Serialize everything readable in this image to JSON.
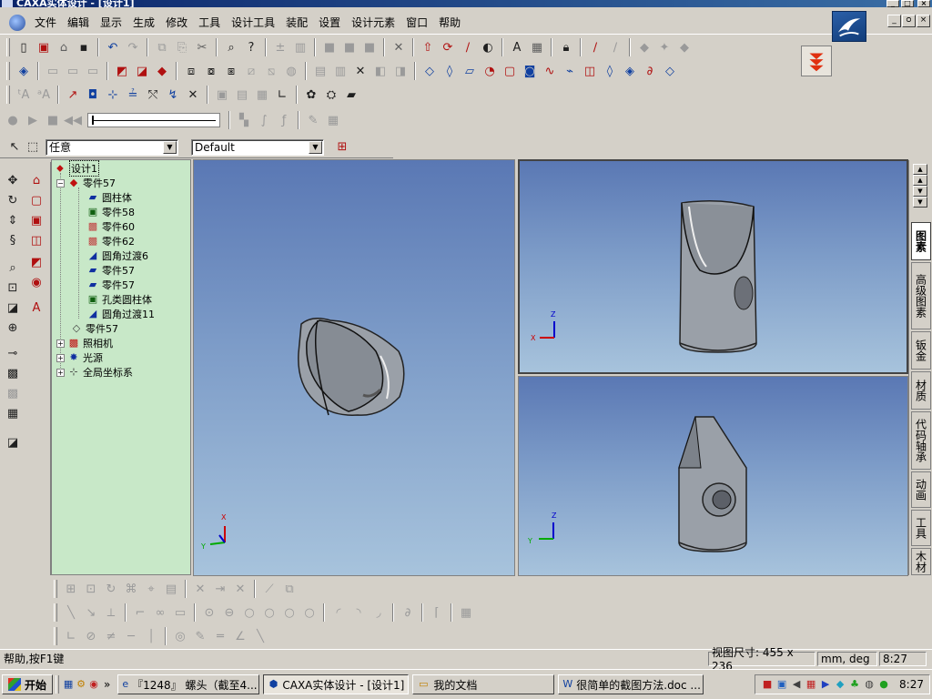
{
  "window": {
    "title": "CAXA实体设计 - [设计1]",
    "min": "_",
    "max": "□",
    "close": "×"
  },
  "menu": {
    "items": [
      "文件",
      "编辑",
      "显示",
      "生成",
      "修改",
      "工具",
      "设计工具",
      "装配",
      "设置",
      "设计元素",
      "窗口",
      "帮助"
    ]
  },
  "mdi": {
    "min": "_",
    "restore": "ᴑ",
    "close": "×"
  },
  "filter": {
    "selection_value": "任意",
    "style_value": "Default"
  },
  "tree": {
    "root": "设计1",
    "part": "零件57",
    "children": [
      "圆柱体",
      "零件58",
      "零件60",
      "零件62",
      "圆角过渡6",
      "零件57",
      "零件57",
      "孔类圆柱体",
      "圆角过渡11"
    ],
    "siblings": [
      "零件57",
      "照相机",
      "光源",
      "全局坐标系"
    ]
  },
  "viewport_axes": {
    "main": {
      "x": "X",
      "y": "Y"
    },
    "top_right": {
      "x": "X",
      "z": "Z"
    },
    "bottom_right": {
      "y": "Y",
      "z": "Z"
    }
  },
  "right_tabs": [
    "图素",
    "高级图素",
    "钣金",
    "材质",
    "代码轴承",
    "动画",
    "工具",
    "木材"
  ],
  "status": {
    "help": "帮助,按F1键",
    "view_size": "视图尺寸: 455 x 236",
    "units": "mm, deg",
    "time": "8:27"
  },
  "taskbar": {
    "start": "开始",
    "quicklaunch_more": "»",
    "tasks": [
      "『1248』 螺头（截至4...",
      "CAXA实体设计 - [设计1]",
      "我的文档",
      "很简单的截图方法.doc ..."
    ],
    "clock": "8:27"
  },
  "icons": {
    "toolbar1": [
      "new-icon",
      "new-design-icon",
      "open-icon",
      "save-icon",
      "undo-icon",
      "redo-icon",
      "copy-icon",
      "paste-icon",
      "cut-icon",
      "find-icon",
      "help-cursor-icon",
      "measure-icon",
      "copy2-icon",
      "block1-icon",
      "block2-icon",
      "block3-icon",
      "block4-icon",
      "tools-icon",
      "pointer-icon",
      "rotate-icon",
      "draw-icon",
      "rotate2-icon",
      "text-icon",
      "dim-icon",
      "lock-icon",
      "pick-icon",
      "pen-icon",
      "grp1-icon",
      "grp2-icon",
      "grp3-icon"
    ]
  },
  "colors": {
    "tree_bg": "#c8e8c8",
    "viewport_top": "#5a78b4",
    "viewport_bottom": "#a7c3dc",
    "title_start": "#0a246a"
  }
}
